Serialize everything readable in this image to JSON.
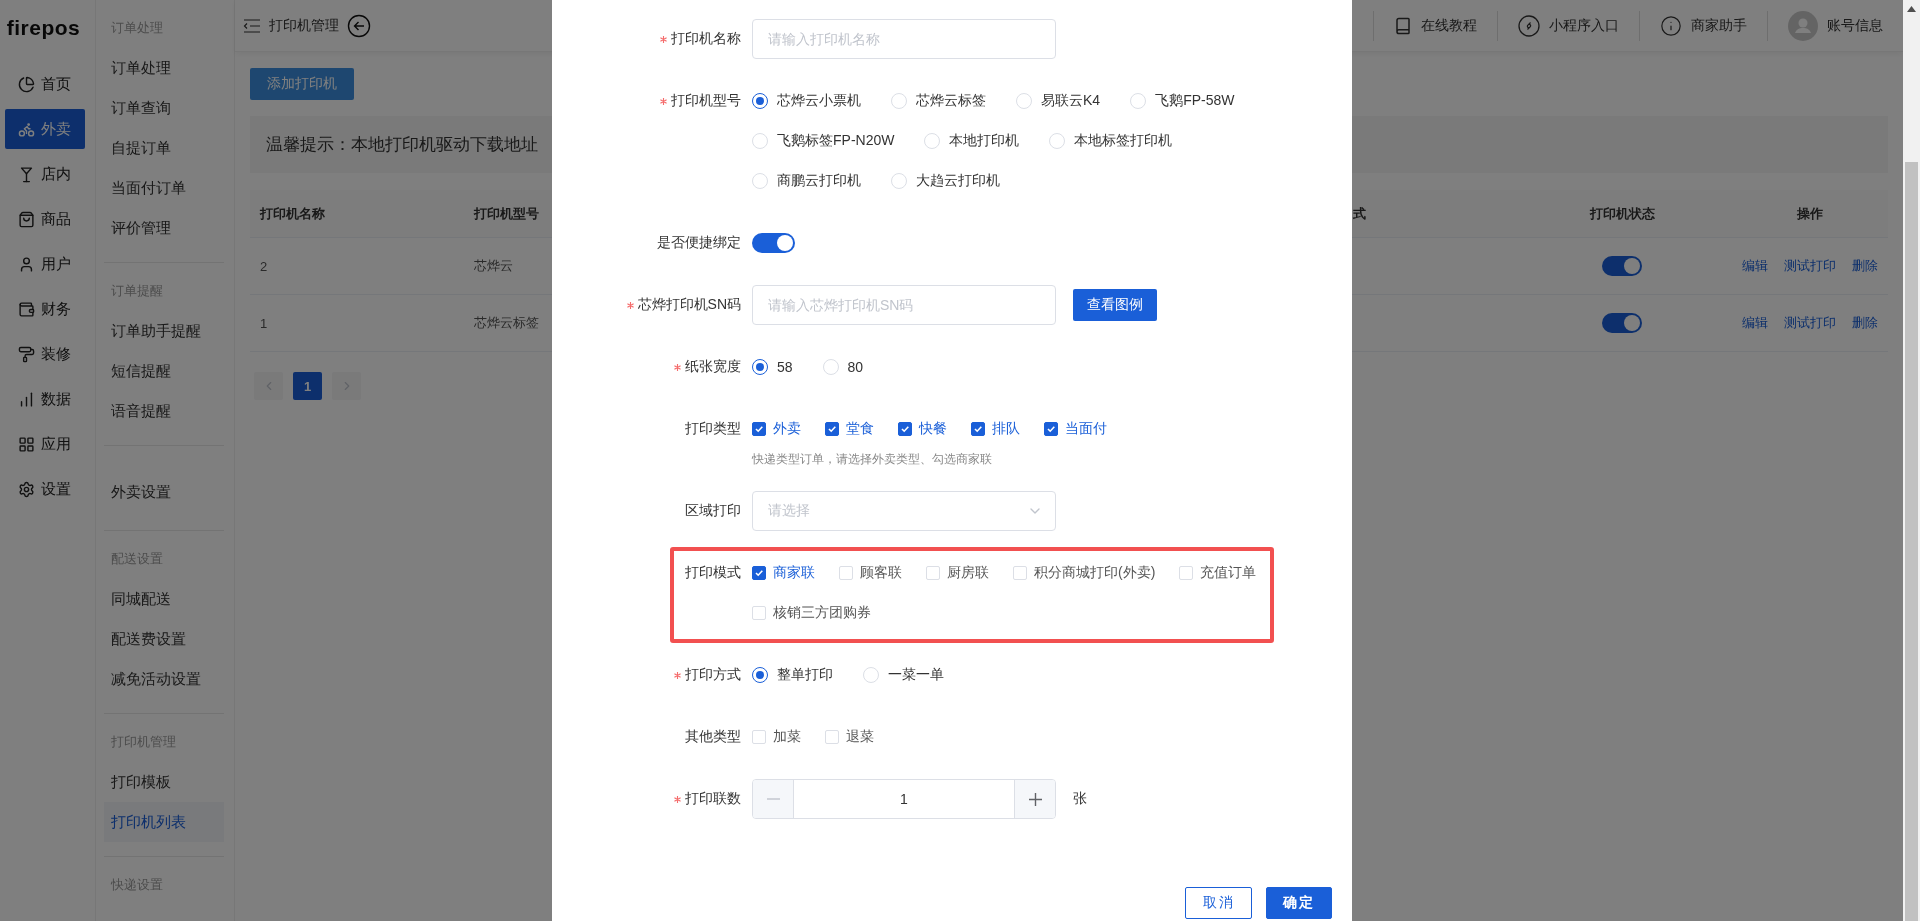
{
  "sidebar": {
    "logo": "firepos",
    "items": [
      {
        "label": "首页",
        "selected": false
      },
      {
        "label": "外卖",
        "selected": true
      },
      {
        "label": "店内",
        "selected": false
      },
      {
        "label": "商品",
        "selected": false
      },
      {
        "label": "用户",
        "selected": false
      },
      {
        "label": "财务",
        "selected": false
      },
      {
        "label": "装修",
        "selected": false
      },
      {
        "label": "数据",
        "selected": false
      },
      {
        "label": "应用",
        "selected": false
      },
      {
        "label": "设置",
        "selected": false
      }
    ]
  },
  "submenu": {
    "groups": [
      {
        "title": "订单处理",
        "items": [
          {
            "label": "订单处理",
            "selected": false
          },
          {
            "label": "订单查询",
            "selected": false
          },
          {
            "label": "自提订单",
            "selected": false
          },
          {
            "label": "当面付订单",
            "selected": false
          },
          {
            "label": "评价管理",
            "selected": false
          }
        ]
      },
      {
        "title": "订单提醒",
        "items": [
          {
            "label": "订单助手提醒",
            "selected": false
          },
          {
            "label": "短信提醒",
            "selected": false
          },
          {
            "label": "语音提醒",
            "selected": false
          }
        ]
      },
      {
        "items": [
          {
            "label": "外卖设置",
            "selected": false
          }
        ]
      },
      {
        "title": "配送设置",
        "items": [
          {
            "label": "同城配送",
            "selected": false
          },
          {
            "label": "配送费设置",
            "selected": false
          },
          {
            "label": "减免活动设置",
            "selected": false
          }
        ]
      },
      {
        "title": "打印机管理",
        "items": [
          {
            "label": "打印模板",
            "selected": false
          },
          {
            "label": "打印机列表",
            "selected": true
          }
        ]
      },
      {
        "title": "快递设置"
      }
    ]
  },
  "header": {
    "title": "打印机管理",
    "links": [
      {
        "label": "在线教程"
      },
      {
        "label": "小程序入口"
      },
      {
        "label": "商家助手"
      },
      {
        "label": "账号信息"
      }
    ]
  },
  "toolbar": {
    "add_button": "添加打印机"
  },
  "notice": "温馨提示：本地打印机驱动下载地址",
  "table": {
    "columns": [
      "打印机名称",
      "打印机型号",
      "式",
      "打印机状态",
      "操作"
    ],
    "rows": [
      {
        "name": "2",
        "model": "芯烨云",
        "enabled": true,
        "actions": [
          "编辑",
          "测试打印",
          "删除"
        ]
      },
      {
        "name": "1",
        "model": "芯烨云标签",
        "enabled": true,
        "actions": [
          "编辑",
          "测试打印",
          "删除"
        ]
      }
    ]
  },
  "pagination": {
    "pages": [
      {
        "label": "1",
        "selected": true
      }
    ]
  },
  "dialog": {
    "fields": [
      {
        "kind": "input",
        "label": "打印机名称",
        "required": true,
        "highlighted": false,
        "placeholder": "请输入打印机名称"
      },
      {
        "kind": "radio",
        "label": "打印机型号",
        "required": true,
        "highlighted": false,
        "options": [
          {
            "label": "芯烨云小票机",
            "selected": true
          },
          {
            "label": "芯烨云标签",
            "selected": false
          },
          {
            "label": "易联云K4",
            "selected": false
          },
          {
            "label": "飞鹅FP-58W",
            "selected": false
          },
          {
            "label": "飞鹅标签FP-N20W",
            "selected": false
          },
          {
            "label": "本地打印机",
            "selected": false
          },
          {
            "label": "本地标签打印机",
            "selected": false
          },
          {
            "label": "商鹏云打印机",
            "selected": false
          },
          {
            "label": "大趋云打印机",
            "selected": false
          }
        ]
      },
      {
        "kind": "switch",
        "label": "是否便捷绑定",
        "required": false,
        "highlighted": false,
        "on": true
      },
      {
        "kind": "input_button",
        "label": "芯烨打印机SN码",
        "required": true,
        "highlighted": false,
        "placeholder": "请输入芯烨打印机SN码",
        "button": "查看图例"
      },
      {
        "kind": "radio",
        "label": "纸张宽度",
        "required": true,
        "highlighted": false,
        "options": [
          {
            "label": "58",
            "selected": true
          },
          {
            "label": "80",
            "selected": false
          }
        ]
      },
      {
        "kind": "checkbox",
        "label": "打印类型",
        "required": false,
        "highlighted": false,
        "options": [
          {
            "label": "外卖",
            "checked": true
          },
          {
            "label": "堂食",
            "checked": true
          },
          {
            "label": "快餐",
            "checked": true
          },
          {
            "label": "排队",
            "checked": true
          },
          {
            "label": "当面付",
            "checked": true
          }
        ],
        "hint": "快递类型订单，请选择外卖类型、勾选商家联"
      },
      {
        "kind": "select",
        "label": "区域打印",
        "required": false,
        "highlighted": false,
        "placeholder": "请选择"
      },
      {
        "kind": "checkbox",
        "label": "打印模式",
        "required": false,
        "highlighted": true,
        "options": [
          {
            "label": "商家联",
            "checked": true
          },
          {
            "label": "顾客联",
            "checked": false
          },
          {
            "label": "厨房联",
            "checked": false
          },
          {
            "label": "积分商城打印(外卖)",
            "checked": false
          },
          {
            "label": "充值订单",
            "checked": false
          },
          {
            "label": "核销三方团购券",
            "checked": false
          }
        ]
      },
      {
        "kind": "radio",
        "label": "打印方式",
        "required": true,
        "highlighted": false,
        "options": [
          {
            "label": "整单打印",
            "selected": true
          },
          {
            "label": "一菜一单",
            "selected": false
          }
        ]
      },
      {
        "kind": "checkbox",
        "label": "其他类型",
        "required": false,
        "highlighted": false,
        "options": [
          {
            "label": "加菜",
            "checked": false
          },
          {
            "label": "退菜",
            "checked": false
          }
        ]
      },
      {
        "kind": "stepper",
        "label": "打印联数",
        "required": true,
        "highlighted": false,
        "value": "1",
        "unit": "张"
      }
    ],
    "buttons": [
      {
        "label": "取消",
        "kind": "secondary"
      },
      {
        "label": "确定",
        "kind": "primary"
      }
    ]
  }
}
